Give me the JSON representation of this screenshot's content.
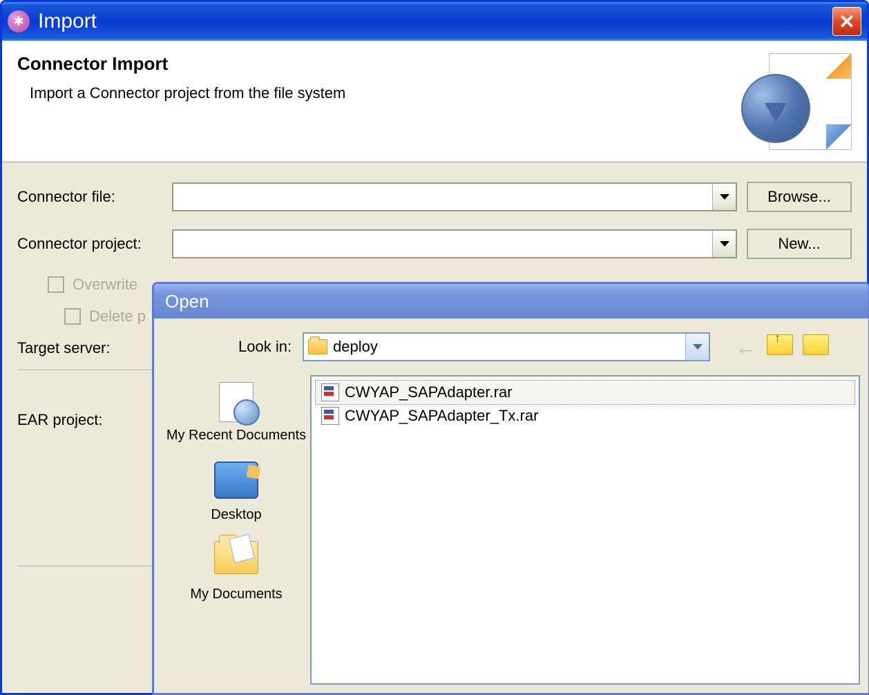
{
  "import_window": {
    "title": "Import",
    "header_title": "Connector Import",
    "header_desc": "Import a Connector project from the file system",
    "labels": {
      "connector_file": "Connector file:",
      "connector_project": "Connector project:",
      "target_server": "Target server:",
      "ear_project": "EAR project:"
    },
    "buttons": {
      "browse": "Browse...",
      "new": "New..."
    },
    "checkboxes": {
      "overwrite": "Overwrite",
      "delete": "Delete p"
    },
    "field_values": {
      "connector_file": "",
      "connector_project": ""
    }
  },
  "open_dialog": {
    "title": "Open",
    "lookin_label": "Look in:",
    "lookin_value": "deploy",
    "places": {
      "recent": "My Recent Documents",
      "desktop": "Desktop",
      "documents": "My Documents"
    },
    "files": [
      {
        "name": "CWYAP_SAPAdapter.rar",
        "selected": true
      },
      {
        "name": "CWYAP_SAPAdapter_Tx.rar",
        "selected": false
      }
    ]
  }
}
